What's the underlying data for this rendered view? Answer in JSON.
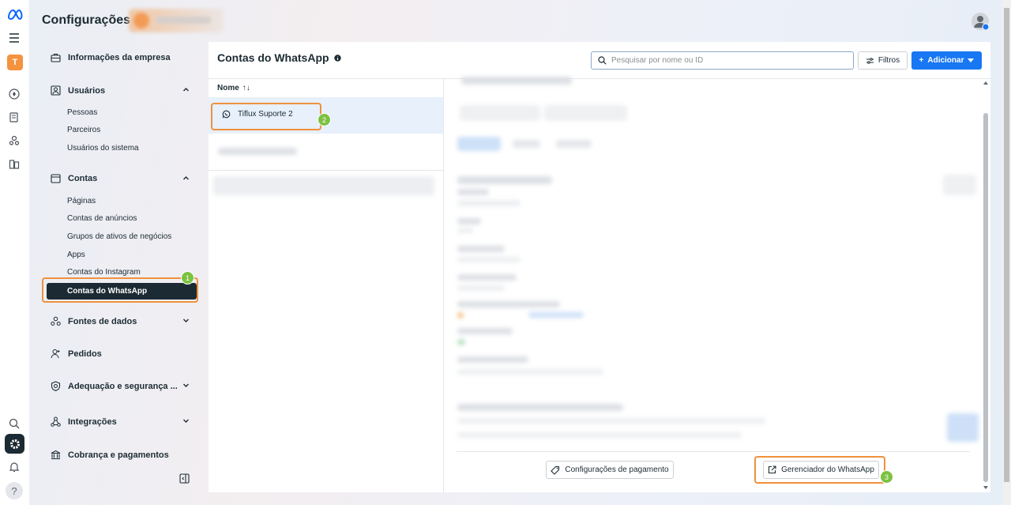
{
  "app": {
    "title": "Configurações"
  },
  "sidebar": {
    "items": [
      {
        "label": "Informações da empresa"
      },
      {
        "label": "Usuários",
        "children": [
          "Pessoas",
          "Parceiros",
          "Usuários do sistema"
        ]
      },
      {
        "label": "Contas",
        "children": [
          "Páginas",
          "Contas de anúncios",
          "Grupos de ativos de negócios",
          "Apps",
          "Contas do Instagram",
          "Contas do WhatsApp"
        ]
      },
      {
        "label": "Fontes de dados"
      },
      {
        "label": "Pedidos"
      },
      {
        "label": "Adequação e segurança ..."
      },
      {
        "label": "Integrações"
      },
      {
        "label": "Cobrança e pagamentos"
      }
    ],
    "active": "Contas do WhatsApp"
  },
  "main": {
    "title": "Contas do WhatsApp",
    "search": {
      "placeholder": "Pesquisar por nome ou ID"
    },
    "filters_label": "Filtros",
    "add_label": "Adicionar",
    "column_name": "Nome",
    "sort_icon": "↑↓",
    "accounts": [
      {
        "name": "Tiflux Suporte 2"
      }
    ],
    "footer": {
      "payment_label": "Configurações de pagamento",
      "manager_label": "Gerenciador do WhatsApp"
    }
  },
  "annotations": [
    "1",
    "2",
    "3"
  ],
  "colors": {
    "accent": "#1877f2",
    "annotation_box": "#f0913c",
    "annotation_badge": "#7cc242",
    "active_nav": "#1c2b33",
    "brand_avatar": "#f5923e"
  }
}
